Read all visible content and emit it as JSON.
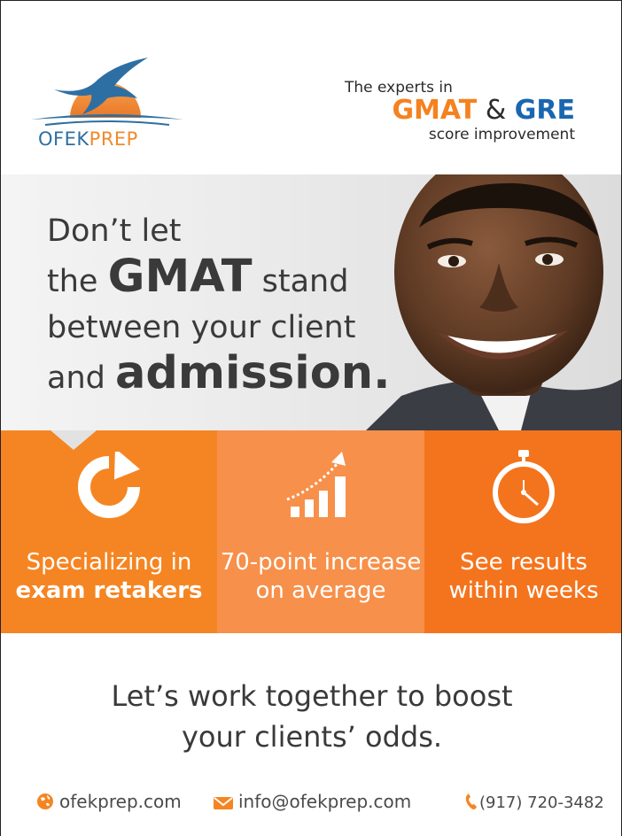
{
  "header": {
    "logo": {
      "word_part1": "OFEK",
      "word_part2": "PREP"
    },
    "tagline": {
      "top": "The experts in",
      "gmat": "GMAT",
      "amp": "&",
      "gre": "GRE",
      "bottom": "score improvement"
    }
  },
  "hero": {
    "line1": "Don’t let",
    "line2_pre": "the ",
    "line2_bold": "GMAT",
    "line2_post": " stand",
    "line3": "between your client",
    "line4_pre": "and ",
    "line4_bold": "admission."
  },
  "features": [
    {
      "icon": "refresh-arrow-icon",
      "line1": "Specializing in",
      "line2": "exam retakers"
    },
    {
      "icon": "growth-chart-icon",
      "line1": "70-point increase",
      "line2": "on average"
    },
    {
      "icon": "stopwatch-icon",
      "line1": "See results",
      "line2": "within weeks"
    }
  ],
  "cta": {
    "line1": "Let’s work together to boost",
    "line2": "your clients’ odds."
  },
  "contacts": {
    "website": "ofekprep.com",
    "email": "info@ofekprep.com",
    "phone": "(917) 720-3482"
  },
  "colors": {
    "orange": "#f58522",
    "orange_light": "#f7904a",
    "orange_dark": "#f4741d",
    "blue": "#1a66b0",
    "text": "#3a3a3a"
  }
}
